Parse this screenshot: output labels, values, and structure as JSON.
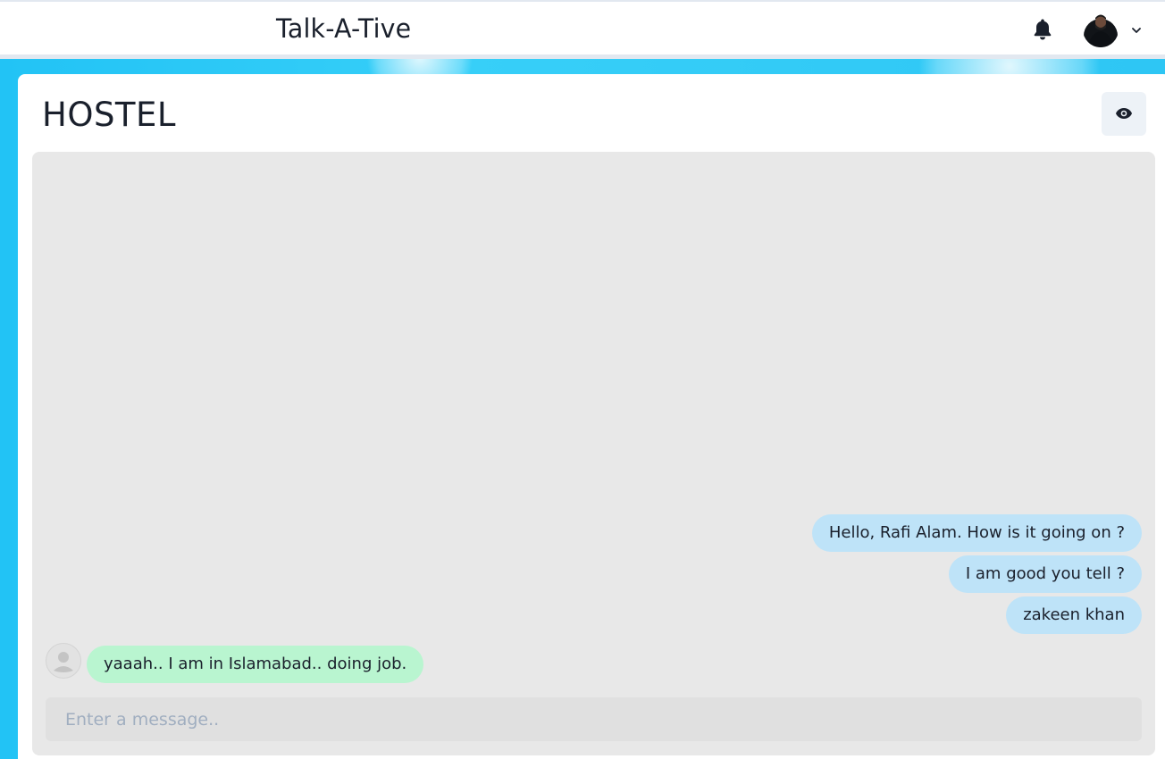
{
  "app": {
    "brand": "Talk-A-Tive"
  },
  "header": {
    "notification_icon": "bell-icon",
    "profile_icon": "avatar",
    "menu_icon": "chevron-down-icon"
  },
  "chat": {
    "title": "HOSTEL",
    "view_icon": "eye-icon",
    "messages": [
      {
        "side": "sent",
        "text": "Hello, Rafi Alam. How is it going on ?"
      },
      {
        "side": "sent",
        "text": "I am good you tell ?"
      },
      {
        "side": "sent",
        "text": "zakeen khan"
      },
      {
        "side": "received",
        "text": "yaaah.. I am in Islamabad.. doing job."
      }
    ],
    "input": {
      "placeholder": "Enter a message..",
      "value": ""
    }
  },
  "colors": {
    "background": "#2ec6f4",
    "sent_bubble": "#bee3f8",
    "received_bubble": "#b9f5d0",
    "chat_area": "#e8e8e8"
  }
}
